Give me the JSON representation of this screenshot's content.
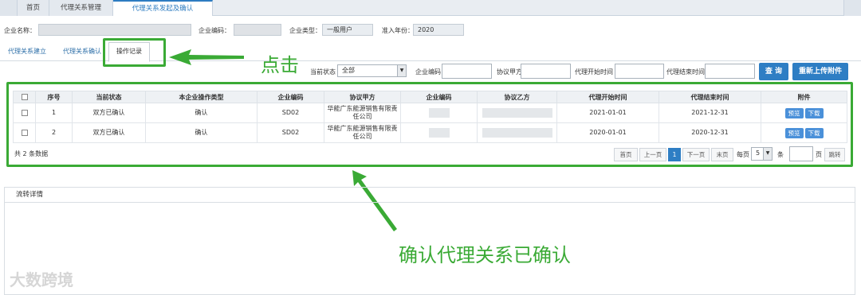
{
  "top_tabs": [
    {
      "label": "首页"
    },
    {
      "label": "代理关系管理"
    },
    {
      "label": "代理关系发起及确认"
    }
  ],
  "info": {
    "company_name_label": "企业名称：",
    "company_code_label": "企业编码：",
    "company_type_label": "企业类型：",
    "company_type_value": "一般用户",
    "year_label": "准入年份：",
    "year_value": "2020"
  },
  "sub_tabs": [
    {
      "label": "代理关系建立"
    },
    {
      "label": "代理关系确认"
    },
    {
      "label": "操作记录"
    }
  ],
  "filters": {
    "status_label": "当前状态",
    "status_value": "全部",
    "code_label": "企业编码",
    "party_a_label": "协议甲方",
    "start_label": "代理开始时间",
    "end_label": "代理结束时间",
    "query_button": "查 询",
    "reupload_button": "重新上传附件"
  },
  "table": {
    "headers": [
      "序号",
      "当前状态",
      "本企业操作类型",
      "企业编码",
      "协议甲方",
      "企业编码",
      "协议乙方",
      "代理开始时间",
      "代理结束时间",
      "附件"
    ],
    "rows": [
      {
        "index": "1",
        "status": "双方已确认",
        "op_type": "确认",
        "code": "SD02",
        "party_a": "华能广东能源销售有限责任公司",
        "start": "2021-01-01",
        "end": "2021-12-31"
      },
      {
        "index": "2",
        "status": "双方已确认",
        "op_type": "确认",
        "code": "SD02",
        "party_a": "华能广东能源销售有限责任公司",
        "start": "2020-01-01",
        "end": "2020-12-31"
      }
    ],
    "preview_label": "预览",
    "download_label": "下载"
  },
  "pagination": {
    "total": "共 2 条数据",
    "first": "首页",
    "prev": "上一页",
    "current": "1",
    "next": "下一页",
    "last": "末页",
    "per_page_label": "每页",
    "per_page_value": "5",
    "per_page_unit": "条",
    "page_unit": "页",
    "jump": "跳转"
  },
  "flow": {
    "title": "流转详情"
  },
  "annotations": {
    "click": "点击",
    "confirm": "确认代理关系已确认"
  },
  "watermark": "大数跨境",
  "colors": {
    "accent": "#2e7ec4",
    "highlight": "#3aaa35"
  }
}
